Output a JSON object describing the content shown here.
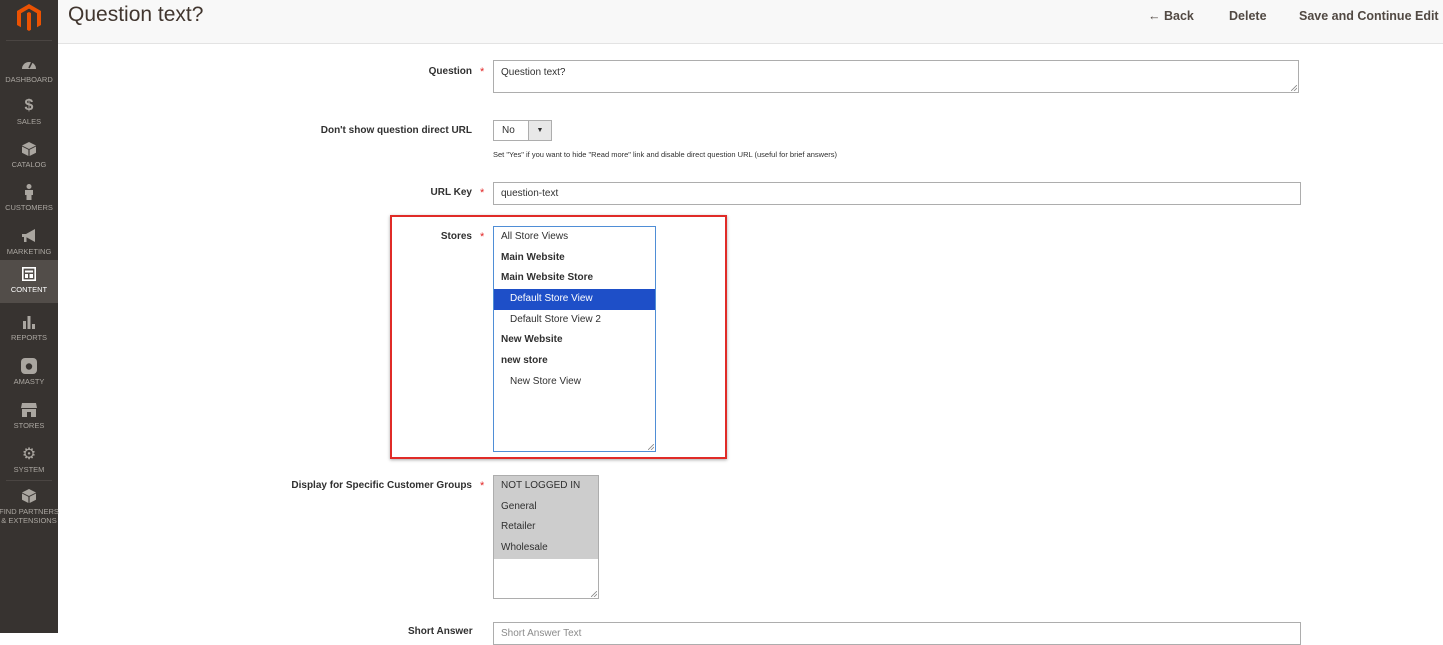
{
  "sidebar": {
    "items": [
      {
        "label": "DASHBOARD",
        "icon": "dashboard-icon"
      },
      {
        "label": "SALES",
        "icon": "dollar-icon"
      },
      {
        "label": "CATALOG",
        "icon": "cube-icon"
      },
      {
        "label": "CUSTOMERS",
        "icon": "person-icon"
      },
      {
        "label": "MARKETING",
        "icon": "megaphone-icon"
      },
      {
        "label": "CONTENT",
        "icon": "layout-icon"
      },
      {
        "label": "REPORTS",
        "icon": "bar-chart-icon"
      },
      {
        "label": "AMASTY",
        "icon": "amasty-icon"
      },
      {
        "label": "STORES",
        "icon": "storefront-icon"
      },
      {
        "label": "SYSTEM",
        "icon": "gear-icon"
      },
      {
        "label": "FIND PARTNERS",
        "label2": "& EXTENSIONS",
        "icon": "box-icon"
      }
    ],
    "active": "CONTENT"
  },
  "header": {
    "title": "Question text?",
    "back_label": "Back",
    "delete_label": "Delete",
    "save_label": "Save and Continue Edit"
  },
  "form": {
    "question": {
      "label": "Question",
      "value": "Question text?"
    },
    "direct_url": {
      "label": "Don't show question direct URL",
      "value": "No",
      "note": "Set \"Yes\" if you want to hide \"Read more\" link and disable direct question URL (useful for brief answers)"
    },
    "url_key": {
      "label": "URL Key",
      "value": "question-text"
    },
    "stores": {
      "label": "Stores",
      "options": [
        {
          "text": "All Store Views",
          "style": "normal"
        },
        {
          "text": "Main Website",
          "style": "bold"
        },
        {
          "text": "Main Website Store",
          "style": "bold"
        },
        {
          "text": "Default Store View",
          "style": "indent",
          "selected": true
        },
        {
          "text": "Default Store View 2",
          "style": "indent"
        },
        {
          "text": "New Website",
          "style": "bold"
        },
        {
          "text": "new store",
          "style": "bold"
        },
        {
          "text": "New Store View",
          "style": "indent"
        }
      ]
    },
    "customer_groups": {
      "label": "Display for Specific Customer Groups",
      "options": [
        "NOT LOGGED IN",
        "General",
        "Retailer",
        "Wholesale"
      ]
    },
    "short_answer": {
      "label": "Short Answer",
      "placeholder": "Short Answer Text"
    }
  },
  "colors": {
    "sidebar_bg": "#373330",
    "logo_orange": "#eb5202",
    "required_star": "#e22626",
    "selected_option": "#1e4fc8",
    "highlight_border": "#e02b27"
  }
}
